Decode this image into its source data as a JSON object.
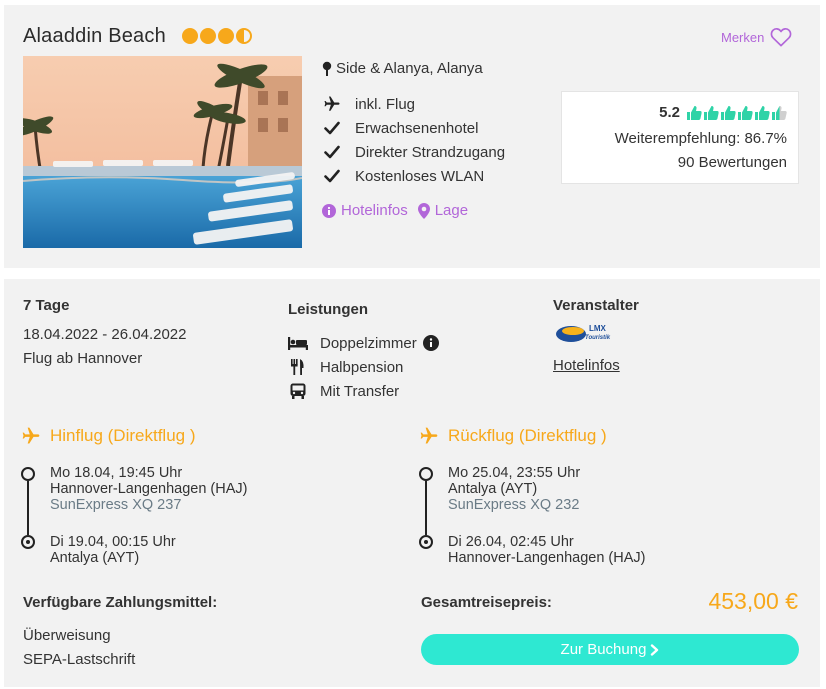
{
  "hotel": {
    "name": "Alaaddin Beach",
    "stars_rating": 3.5,
    "star_color": "#f7a81b",
    "merken_label": "Merken",
    "location": "Side & Alanya, Alanya",
    "features": [
      {
        "icon": "plane-icon",
        "label": "inkl. Flug"
      },
      {
        "icon": "check-icon",
        "label": "Erwachsenenhotel"
      },
      {
        "icon": "check-icon",
        "label": "Direkter Strandzugang"
      },
      {
        "icon": "check-icon",
        "label": "Kostenloses WLAN"
      }
    ],
    "links": {
      "hotelinfos": "Hotelinfos",
      "lage": "Lage"
    },
    "rating": {
      "score": "5.2",
      "thumbs_rating": 5.5,
      "thumbs_max": 6,
      "recommendation": "Weiterempfehlung: 86.7%",
      "reviews": "90 Bewertungen"
    }
  },
  "offer": {
    "duration": "7 Tage",
    "dates": "18.04.2022 - 26.04.2022",
    "departure": "Flug ab Hannover",
    "services_title": "Leistungen",
    "services": [
      {
        "icon": "bed-icon",
        "label": "Doppelzimmer",
        "info": true
      },
      {
        "icon": "cutlery-icon",
        "label": "Halbpension",
        "info": false
      },
      {
        "icon": "bus-icon",
        "label": "Mit Transfer",
        "info": false
      }
    ],
    "organizer_title": "Veranstalter",
    "organizer_logo": "LMX Touristik",
    "organizer_link": "Hotelinfos",
    "outbound": {
      "title": "Hinflug (Direktflug )",
      "dep_time": "Mo 18.04, 19:45 Uhr",
      "dep_airport": "Hannover-Langenhagen (HAJ)",
      "airline": "SunExpress XQ 237",
      "arr_time": "Di 19.04, 00:15 Uhr",
      "arr_airport": "Antalya (AYT)"
    },
    "return": {
      "title": "Rückflug (Direktflug )",
      "dep_time": "Mo 25.04, 23:55 Uhr",
      "dep_airport": "Antalya (AYT)",
      "airline": "SunExpress XQ 232",
      "arr_time": "Di 26.04, 02:45 Uhr",
      "arr_airport": "Hannover-Langenhagen (HAJ)"
    },
    "payment_title": "Verfügbare Zahlungsmittel:",
    "payment_methods": [
      "Überweisung",
      "SEPA-Lastschrift"
    ],
    "total_label": "Gesamtreisepreis:",
    "total_price": "453,00 €",
    "book_button": "Zur Buchung"
  },
  "colors": {
    "accent_orange": "#f7a81b",
    "accent_purple": "#b266d9",
    "button_teal": "#2ee8d2",
    "thumb_green": "#2fd3a7"
  }
}
